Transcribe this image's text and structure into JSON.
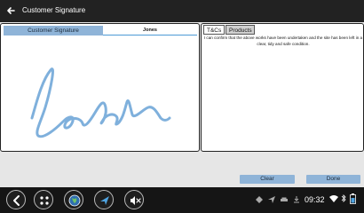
{
  "header": {
    "title": "Customer Signature"
  },
  "signature": {
    "label": "Customer Signature",
    "name": "Jones"
  },
  "terms": {
    "tabs": [
      {
        "label": "T&Cs",
        "active": true
      },
      {
        "label": "Products",
        "active": false
      }
    ],
    "text": "I can confirm that the above works have been undertaken and the site has been left in a clear, tidy and safe condition."
  },
  "actions": {
    "clear_label": "Clear",
    "done_label": "Done"
  },
  "status_bar": {
    "time": "09:32"
  },
  "colors": {
    "accent": "#8fb4d8",
    "signature_ink": "#7fb0dc",
    "title_bar": "#222222",
    "nav_bar": "#151515"
  },
  "icons": {
    "back": "back-arrow-icon",
    "nav_back": "nav-back-icon",
    "apps": "apps-grid-icon",
    "globe": "globe-icon",
    "navigation": "navigation-arrow-icon",
    "mute": "volume-mute-icon"
  }
}
